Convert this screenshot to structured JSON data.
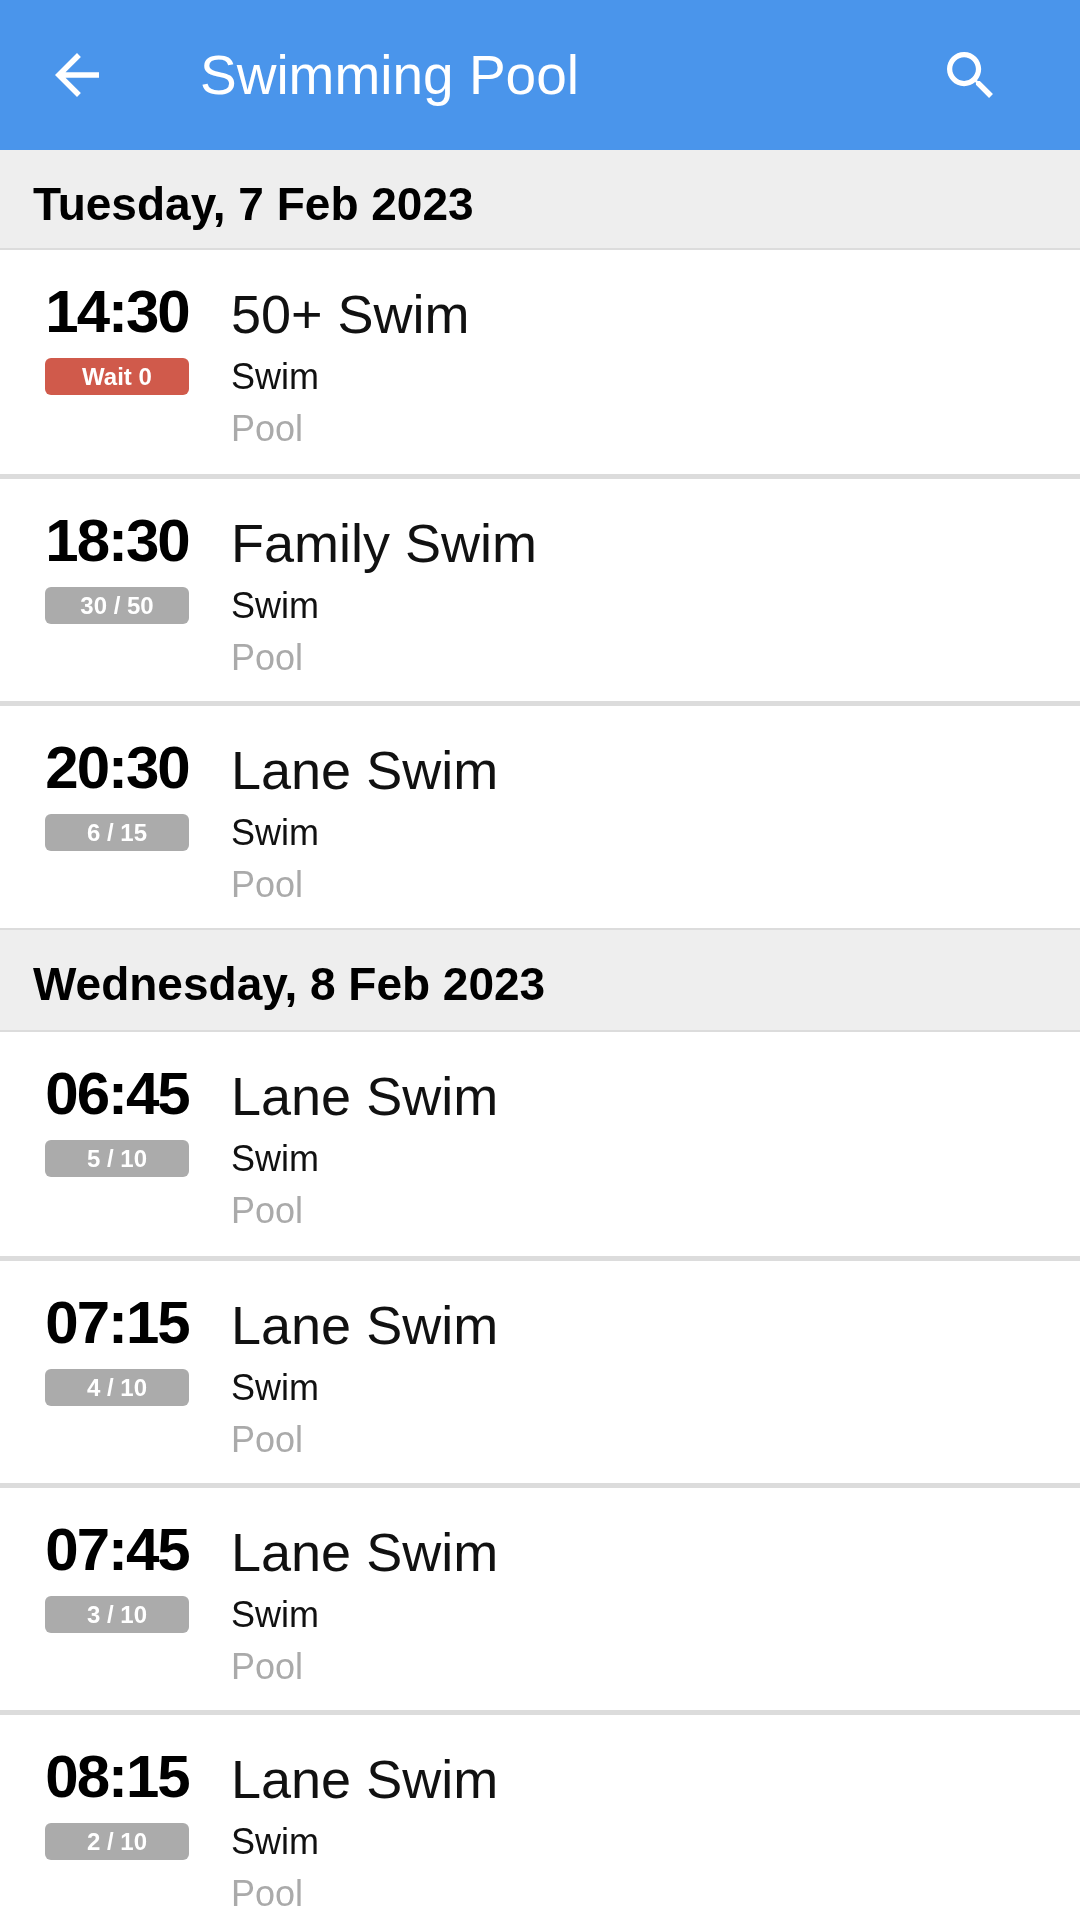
{
  "app_bar": {
    "title": "Swimming Pool"
  },
  "days": [
    {
      "date": "Tuesday, 7 Feb 2023",
      "sessions": [
        {
          "time": "14:30",
          "availability": {
            "text": "Wait 0",
            "kind": "waitlist"
          },
          "name": "50+ Swim",
          "category": "Swim",
          "location": "Pool"
        },
        {
          "time": "18:30",
          "availability": {
            "text": "30 / 50",
            "kind": "spaces"
          },
          "name": "Family Swim",
          "category": "Swim",
          "location": "Pool"
        },
        {
          "time": "20:30",
          "availability": {
            "text": "6 / 15",
            "kind": "spaces"
          },
          "name": "Lane Swim",
          "category": "Swim",
          "location": "Pool"
        }
      ]
    },
    {
      "date": "Wednesday, 8 Feb 2023",
      "sessions": [
        {
          "time": "06:45",
          "availability": {
            "text": "5 / 10",
            "kind": "spaces"
          },
          "name": "Lane Swim",
          "category": "Swim",
          "location": "Pool"
        },
        {
          "time": "07:15",
          "availability": {
            "text": "4 / 10",
            "kind": "spaces"
          },
          "name": "Lane Swim",
          "category": "Swim",
          "location": "Pool"
        },
        {
          "time": "07:45",
          "availability": {
            "text": "3 / 10",
            "kind": "spaces"
          },
          "name": "Lane Swim",
          "category": "Swim",
          "location": "Pool"
        },
        {
          "time": "08:15",
          "availability": {
            "text": "2 / 10",
            "kind": "spaces"
          },
          "name": "Lane Swim",
          "category": "Swim",
          "location": "Pool"
        }
      ]
    }
  ]
}
